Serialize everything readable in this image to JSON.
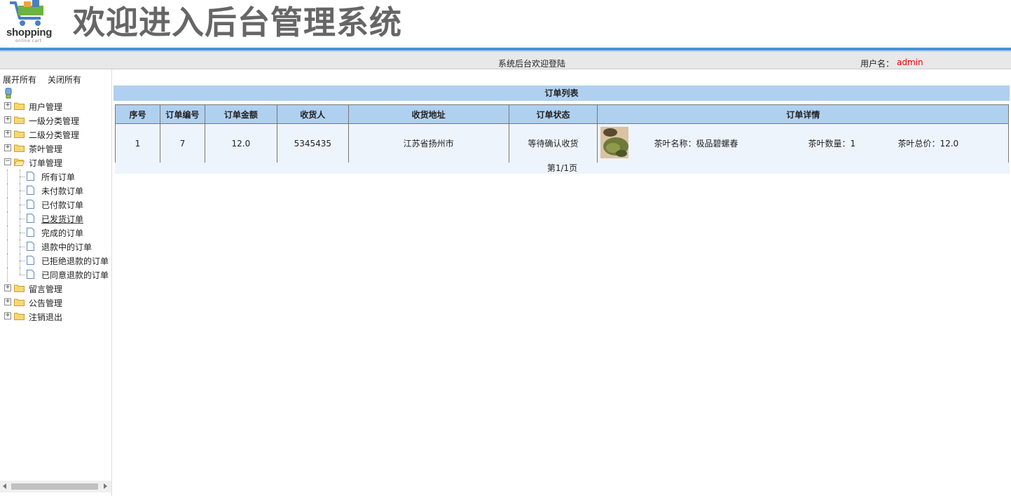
{
  "header": {
    "logo_brand": "shopping",
    "logo_tag": "online cart",
    "title": "欢迎进入后台管理系统"
  },
  "statusbar": {
    "welcome": "系统后台欢迎登陆",
    "user_label": "用户名：",
    "user_name": "admin"
  },
  "sidebar": {
    "expand_all": "展开所有",
    "collapse_all": "关闭所有",
    "nodes": [
      {
        "label": "用户管理",
        "expanded": false
      },
      {
        "label": "一级分类管理",
        "expanded": false
      },
      {
        "label": "二级分类管理",
        "expanded": false
      },
      {
        "label": "茶叶管理",
        "expanded": false
      },
      {
        "label": "订单管理",
        "expanded": true
      },
      {
        "label": "留言管理",
        "expanded": false
      },
      {
        "label": "公告管理",
        "expanded": false
      },
      {
        "label": "注销退出",
        "expanded": false
      }
    ],
    "order_children": [
      "所有订单",
      "未付款订单",
      "已付款订单",
      "已发货订单",
      "完成的订单",
      "退款中的订单",
      "已拒绝退款的订单",
      "已同意退款的订单"
    ]
  },
  "main": {
    "list_title": "订单列表",
    "columns": [
      "序号",
      "订单编号",
      "订单金额",
      "收货人",
      "收货地址",
      "订单状态",
      "订单详情"
    ],
    "rows": [
      {
        "index": "1",
        "order_no": "7",
        "amount": "12.0",
        "receiver": "5345435",
        "address": "江苏省扬州市",
        "status": "等待确认收货",
        "detail_name": "茶叶名称：极品碧螺春",
        "detail_qty": "茶叶数量：1",
        "detail_total": "茶叶总价：12.0"
      }
    ],
    "pager": "第1/1页"
  },
  "colors": {
    "accent_blue": "#4a90d6",
    "table_header": "#b0d0f0",
    "table_cell": "#eef4fb",
    "username_red": "#e00000"
  }
}
